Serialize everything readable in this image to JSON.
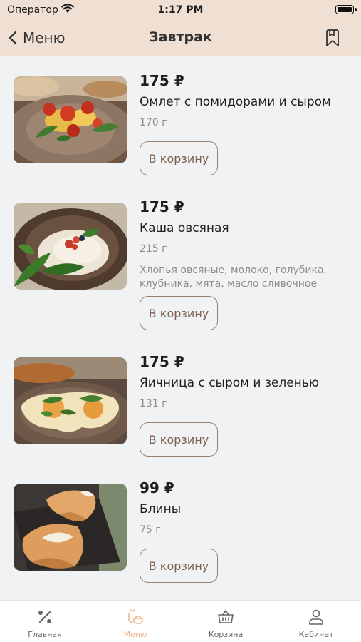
{
  "status": {
    "carrier": "Оператор",
    "time": "1:17 PM"
  },
  "nav": {
    "back_label": "Меню",
    "title": "Завтрак"
  },
  "products": [
    {
      "price": "175 ₽",
      "name": "Омлет с помидорами и сыром",
      "weight": "170 г",
      "description": "",
      "button": "В корзину"
    },
    {
      "price": "175 ₽",
      "name": "Каша овсяная",
      "weight": "215 г",
      "description": "Хлопья овсяные, молоко, голубика, клубника, мята, масло сливочное",
      "button": "В корзину"
    },
    {
      "price": "175 ₽",
      "name": "Яичница с сыром и зеленью",
      "weight": "131 г",
      "description": "",
      "button": "В корзину"
    },
    {
      "price": "99 ₽",
      "name": "Блины",
      "weight": "75 г",
      "description": "",
      "button": "В корзину"
    }
  ],
  "tabs": [
    {
      "label": "Главная",
      "icon": "percent-icon"
    },
    {
      "label": "Меню",
      "icon": "menu-dish-icon",
      "active": true
    },
    {
      "label": "Корзина",
      "icon": "basket-icon"
    },
    {
      "label": "Кабинет",
      "icon": "person-icon"
    }
  ],
  "colors": {
    "header_bg": "#efe0d3",
    "page_bg": "#f1f2f4",
    "button_border": "#9a8170",
    "button_text": "#7d6050",
    "active_tab": "#e8b791"
  }
}
